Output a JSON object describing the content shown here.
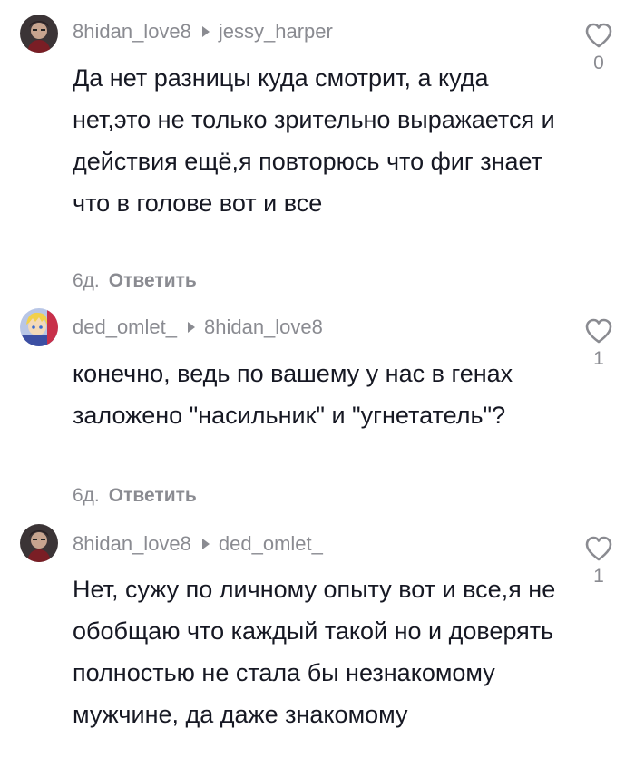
{
  "comments": [
    {
      "author": "8hidan_love8",
      "reply_to": "jessy_harper",
      "text": "Да нет разницы куда смотрит, а куда нет,это не только зрительно выражается и действия ещё,я повторюсь что фиг знает что в голове вот и все",
      "age": "6д.",
      "reply_label": "Ответить",
      "likes": "0",
      "avatar_icon": "user-avatar-dark"
    },
    {
      "author": "ded_omlet_",
      "reply_to": "8hidan_love8",
      "text": "конечно, ведь по вашему у нас в генах заложено \"насильник\" и \"угнетатель\"?",
      "age": "6д.",
      "reply_label": "Ответить",
      "likes": "1",
      "avatar_icon": "user-avatar-anime"
    },
    {
      "author": "8hidan_love8",
      "reply_to": "ded_omlet_",
      "text": "Нет, сужу по личному опыту вот и все,я не обобщаю что каждый такой но и доверять полностью не стала бы незнакомому мужчине, да даже знакомому",
      "age": "",
      "reply_label": "",
      "likes": "1",
      "avatar_icon": "user-avatar-dark"
    }
  ],
  "colors": {
    "text": "#161823",
    "muted": "#8a8b91"
  }
}
